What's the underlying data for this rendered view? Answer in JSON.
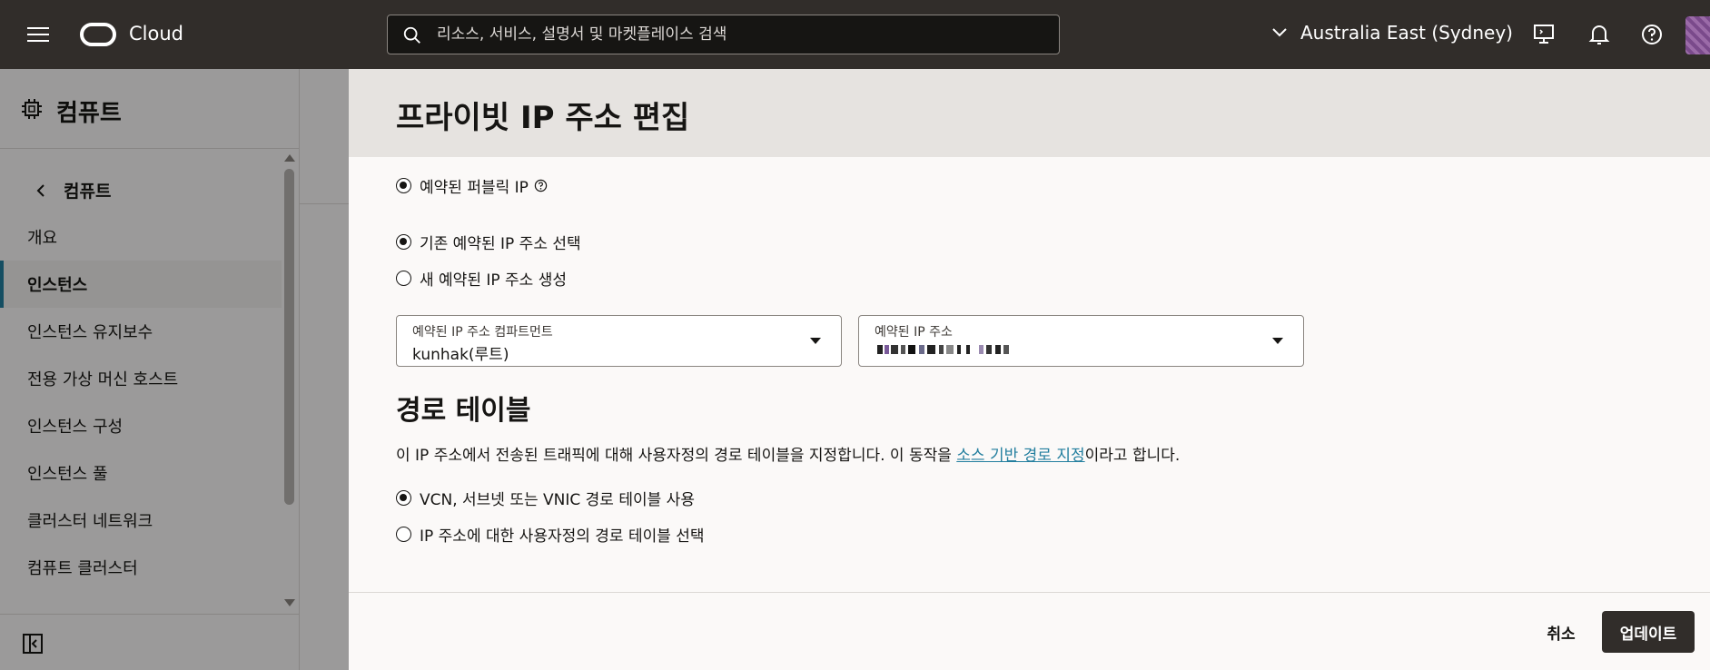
{
  "topbar": {
    "brand": "Cloud",
    "search_placeholder": "리소스, 서비스, 설명서 및 마켓플레이스 검색",
    "region": "Australia East (Sydney)"
  },
  "sidebar": {
    "title": "컴퓨트",
    "back_label": "컴퓨트",
    "items": [
      {
        "label": "개요"
      },
      {
        "label": "인스턴스"
      },
      {
        "label": "인스턴스 유지보수"
      },
      {
        "label": "전용 가상 머신 호스트"
      },
      {
        "label": "인스턴스 구성"
      },
      {
        "label": "인스턴스 풀"
      },
      {
        "label": "클러스터 네트워크"
      },
      {
        "label": "컴퓨트 클러스터"
      }
    ]
  },
  "panel": {
    "title": "프라이빗 IP 주소 편집",
    "reserved_public_ip": "예약된 퍼블릭 IP",
    "option_existing": "기존 예약된 IP 주소 선택",
    "option_new": "새 예약된 IP 주소 생성",
    "compartment_label": "예약된 IP 주소 컴파트먼트",
    "compartment_value": "kunhak(루트)",
    "reserved_ip_label": "예약된 IP 주소",
    "route_title": "경로 테이블",
    "route_desc_before": "이 IP 주소에서 전송된 트래픽에 대해 사용자정의 경로 테이블을 지정합니다. 이 동작을 ",
    "route_desc_link": "소스 기반 경로 지정",
    "route_desc_after": "이라고 합니다.",
    "route_option_default": "VCN, 서브넷 또는 VNIC 경로 테이블 사용",
    "route_option_custom": "IP 주소에 대한 사용자정의 경로 테이블 선택",
    "cancel": "취소",
    "update": "업데이트"
  },
  "colors": {
    "topbar": "#312d2a",
    "accent_link": "#227e9e",
    "primary_button": "#312d2a"
  }
}
